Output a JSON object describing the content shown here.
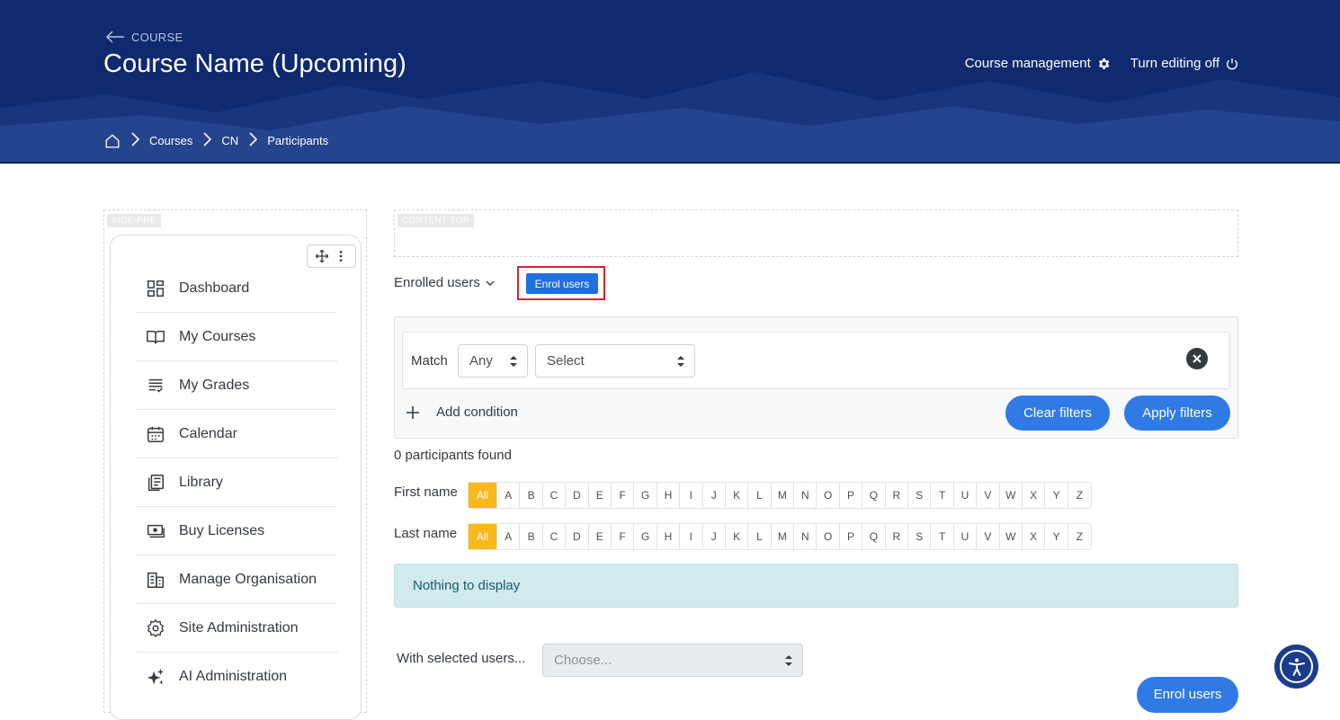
{
  "header": {
    "back_label": "COURSE",
    "title": "Course Name (Upcoming)",
    "course_management": "Course management",
    "turn_editing_off": "Turn editing off",
    "bg_color": "#0f2a6e"
  },
  "breadcrumb": [
    "Courses",
    "CN",
    "Participants"
  ],
  "regions": {
    "side": "SIDE-PRE",
    "content": "CONTENT-TOP"
  },
  "sidebar": {
    "items": [
      {
        "label": "Dashboard",
        "icon": "dashboard-icon"
      },
      {
        "label": "My Courses",
        "icon": "book-open-icon"
      },
      {
        "label": "My Grades",
        "icon": "grades-list-icon"
      },
      {
        "label": "Calendar",
        "icon": "calendar-icon"
      },
      {
        "label": "Library",
        "icon": "library-icon"
      },
      {
        "label": "Buy Licenses",
        "icon": "licenses-icon"
      },
      {
        "label": "Manage Organisation",
        "icon": "organisation-icon"
      },
      {
        "label": "Site Administration",
        "icon": "gear-icon"
      },
      {
        "label": "AI Administration",
        "icon": "sparkles-icon"
      }
    ]
  },
  "main": {
    "enrolled_menu": "Enrolled users",
    "enrol_button": "Enrol users",
    "filter": {
      "match_label": "Match",
      "match_value": "Any",
      "type_value": "Select",
      "add_condition": "Add condition",
      "clear_filters": "Clear filters",
      "apply_filters": "Apply filters"
    },
    "found": "0 participants found",
    "first_name_label": "First name",
    "last_name_label": "Last name",
    "initials": [
      "All",
      "A",
      "B",
      "C",
      "D",
      "E",
      "F",
      "G",
      "H",
      "I",
      "J",
      "K",
      "L",
      "M",
      "N",
      "O",
      "P",
      "Q",
      "R",
      "S",
      "T",
      "U",
      "V",
      "W",
      "X",
      "Y",
      "Z"
    ],
    "nothing": "Nothing to display",
    "with_selected": "With selected users...",
    "choose_placeholder": "Choose...",
    "enrol_bottom": "Enrol users"
  },
  "colors": {
    "accent": "#2f7ae5",
    "active_initial": "#fbb81b",
    "highlight_border": "#d9232f",
    "info_bg": "#d1eaee"
  }
}
